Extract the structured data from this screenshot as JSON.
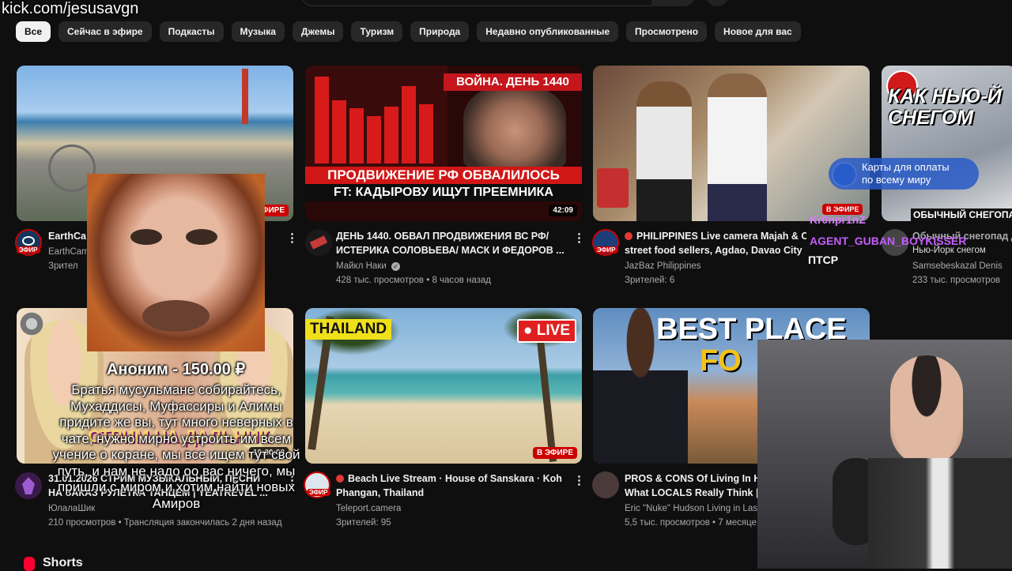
{
  "watermark": "kick.com/jesusavgn",
  "chips": [
    "Все",
    "Сейчас в эфире",
    "Подкасты",
    "Музыка",
    "Джемы",
    "Туризм",
    "Природа",
    "Недавно опубликованные",
    "Просмотрено",
    "Новое для вас"
  ],
  "videos": [
    {
      "channel_title": "EarthCa",
      "channel": "EarthCam",
      "meta": "Зрител",
      "badge": "В ЭФИРЕ",
      "avatar_badge": "ЭФИР"
    },
    {
      "title1": "ДЕНЬ 1440. ОБВАЛ ПРОДВИЖЕНИЯ ВС РФ/",
      "title2": "ИСТЕРИКА СОЛОВЬЕВА/ МАСК И ФЕДОРОВ ...",
      "channel": "Майкл Наки",
      "meta": "428 тыс. просмотров • 8 часов назад",
      "duration": "42:09",
      "thumb_title": "ВОЙНА. ДЕНЬ 1440",
      "thumb_line1": "ПРОДВИЖЕНИЕ РФ ОБВАЛИЛОСЬ",
      "thumb_line2": "FT: КАДЫРОВУ ИЩУТ ПРЕЕМНИКА"
    },
    {
      "title1": "PHILIPPINES Live camera Majah & Carolina",
      "title2": "street food sellers, Agdao, Davao City ...",
      "channel": "JazBaz Philippines",
      "meta": "Зрителей: 6",
      "avatar_badge": "ЭФИР"
    },
    {
      "title1": "Обычный снегопад Д",
      "title2": "Нью-Йорк снегом",
      "channel": "Samsebeskazal Denis",
      "meta": "233 тыс. просмотров",
      "thumb_title": "КАК НЬЮ-Й СНЕГОМ"
    },
    {
      "title1": "31.01.2026 СТРИМ МУЗЫКАЛЬНЫЙ, ПЕСНИ",
      "title2": "НА ЗАКАЗ РУЛЕТКА ТАНЦЕМ | YEATREVEL ...",
      "channel": "ЮлалаШик",
      "meta": "210 просмотров • Трансляция закончилась 2 дня назад",
      "duration": "10:00:00",
      "thumb_title": "СТРИМ НА ДАЛЬНИК"
    },
    {
      "title1": "Beach Live Stream · House of Sanskara · Koh",
      "title2": "Phangan, Thailand",
      "channel": "Teleport.camera",
      "meta": "Зрителей: 95",
      "badge": "В ЭФИРЕ",
      "avatar_badge": "ЭФИР",
      "thumb_title": "THAILAND",
      "live_badge": "LIVE"
    },
    {
      "title1": "PROS & CONS Of Living In H",
      "title2": "What LOCALS Really Think |",
      "channel": "Eric \"Nuke\" Hudson Living in Las",
      "meta": "5,5 тыс. просмотров • 7 месяце",
      "thumb_title": "BEST PLACE",
      "thumb_title2": "FO"
    }
  ],
  "donation": {
    "header": "Аноним - 150.00 ₽",
    "message": "Братья мусульмане собирайтесь, Мухаддисы, Муфассиры и Алимы придите же вы, тут много неверных в чате, нужно мирно устроить им всем учение о коране, мы все ищем тут свой путь, и нам не надо оо вас ничего, мы пришли с миром и хотим найти новых Амиров"
  },
  "chat": {
    "ad_text1": "Карты для оплаты",
    "ad_text2": "по всему миру",
    "live": "В ЭФИРЕ",
    "user1": "Kr0npr1nZ",
    "user2": "AGENT_GUBAN_BOYKISSER",
    "msg2": "ПТСР",
    "snow": "ОБЫЧНЫЙ СНЕГОПА"
  },
  "shorts_label": "Shorts",
  "colors": {
    "live_red": "#cc0000",
    "chip_bg": "#272727",
    "bg": "#0f0f0f"
  }
}
